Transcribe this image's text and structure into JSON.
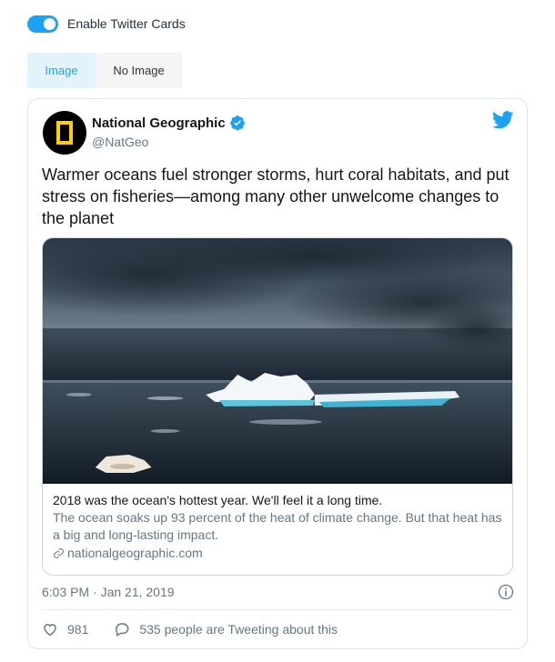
{
  "settings": {
    "toggle_label": "Enable Twitter Cards",
    "toggle_on": true,
    "tabs": [
      {
        "label": "Image",
        "active": true
      },
      {
        "label": "No Image",
        "active": false
      }
    ]
  },
  "tweet": {
    "author": {
      "name": "National Geographic",
      "handle": "@NatGeo",
      "verified": true
    },
    "text": "Warmer oceans fuel stronger storms, hurt coral habitats, and put stress on fisheries—among many other unwelcome changes to the planet",
    "link_card": {
      "title": "2018 was the ocean's hottest year. We'll feel it a long time.",
      "description": "The ocean soaks up 93 percent of the heat of climate change. But that heat has a big and long-lasting impact.",
      "domain": "nationalgeographic.com"
    },
    "timestamp": "6:03 PM · Jan 21, 2019",
    "likes": "981",
    "discussion": "535 people are Tweeting about this"
  },
  "colors": {
    "accent": "#1da1f2",
    "natgeo_yellow": "#ffce00",
    "muted_text": "#657786"
  },
  "icons": [
    "twitter-bird-icon",
    "verified-badge-icon",
    "link-icon",
    "info-icon",
    "heart-icon",
    "comment-icon"
  ]
}
